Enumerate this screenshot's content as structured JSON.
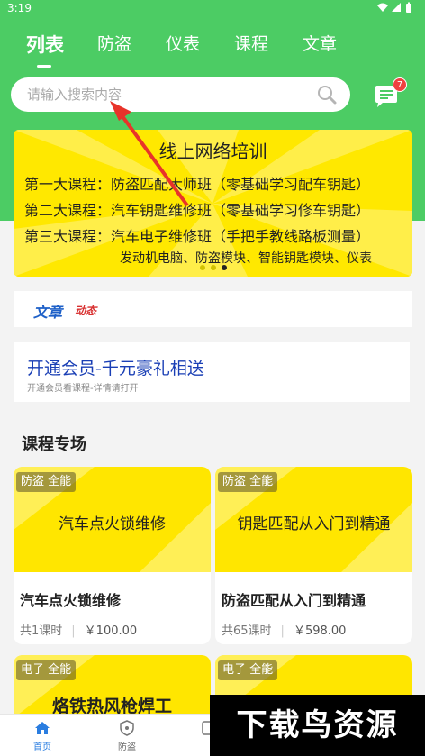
{
  "status_bar": {
    "time": "3:19",
    "indicators": "wifi-icon signal-icon battery-icon"
  },
  "tabs": [
    {
      "label": "列表",
      "active": true
    },
    {
      "label": "防盗",
      "active": false
    },
    {
      "label": "仪表",
      "active": false
    },
    {
      "label": "课程",
      "active": false
    },
    {
      "label": "文章",
      "active": false
    }
  ],
  "search": {
    "placeholder": "请输入搜索内容",
    "value": ""
  },
  "messages": {
    "badge": "7"
  },
  "banner": {
    "title": "线上网络培训",
    "lines": [
      "第一大课程：防盗匹配大师班（零基础学习配车钥匙）",
      "第二大课程：汽车钥匙维修班（零基础学习修车钥匙）",
      "第三大课程：汽车电子维修班（手把手教线路板测量）",
      "发动机电脑、防盗模块、智能钥匙模块、仪表"
    ],
    "slide_count": 3,
    "active_slide": 3
  },
  "news": {
    "word1": "文章",
    "word2": "动态"
  },
  "vip": {
    "title": "开通会员-千元豪礼相送",
    "subtitle": "开通会员看课程-详情请打开"
  },
  "section": {
    "title": "课程专场"
  },
  "courses": [
    {
      "tag": "防盗 全能",
      "cover_title": "汽车点火锁维修",
      "name": "汽车点火锁维修",
      "lessons": "共1课时",
      "price": "￥100.00"
    },
    {
      "tag": "防盗 全能",
      "cover_title": "钥匙匹配从入门到精通",
      "name": "防盗匹配从入门到精通",
      "lessons": "共65课时",
      "price": "￥598.00"
    },
    {
      "tag": "电子 全能",
      "cover_title": "烙铁热风枪焊工"
    },
    {
      "tag": "电子 全能",
      "cover_title": ""
    }
  ],
  "bottom_nav": [
    {
      "label": "首页",
      "icon": "home-icon",
      "active": true
    },
    {
      "label": "防盗",
      "icon": "shield-icon",
      "active": false
    },
    {
      "label": "",
      "icon": "meter-icon",
      "active": false
    }
  ],
  "watermark": "下载鸟资源",
  "colors": {
    "header_green": "#4ccc64",
    "banner_yellow": "#ffe800",
    "accent_blue": "#2a7de0",
    "vip_blue": "#1a3fb5",
    "badge_red": "#f04040"
  }
}
